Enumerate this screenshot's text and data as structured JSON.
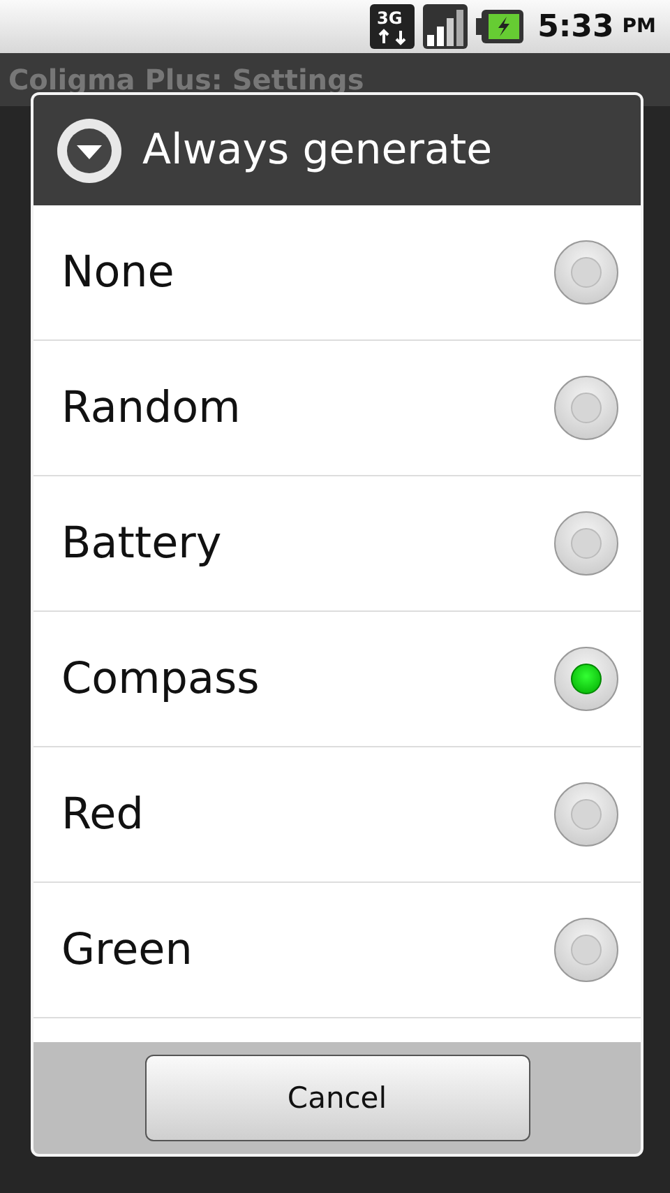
{
  "status_bar": {
    "network": "3G",
    "time": "5:33",
    "meridiem": "PM"
  },
  "app_bar": {
    "title": "Coligma Plus: Settings"
  },
  "dialog": {
    "title": "Always generate",
    "options": [
      {
        "label": "None",
        "selected": false
      },
      {
        "label": "Random",
        "selected": false
      },
      {
        "label": "Battery",
        "selected": false
      },
      {
        "label": "Compass",
        "selected": true
      },
      {
        "label": "Red",
        "selected": false
      },
      {
        "label": "Green",
        "selected": false
      }
    ],
    "buttons": [
      "Cancel"
    ]
  }
}
